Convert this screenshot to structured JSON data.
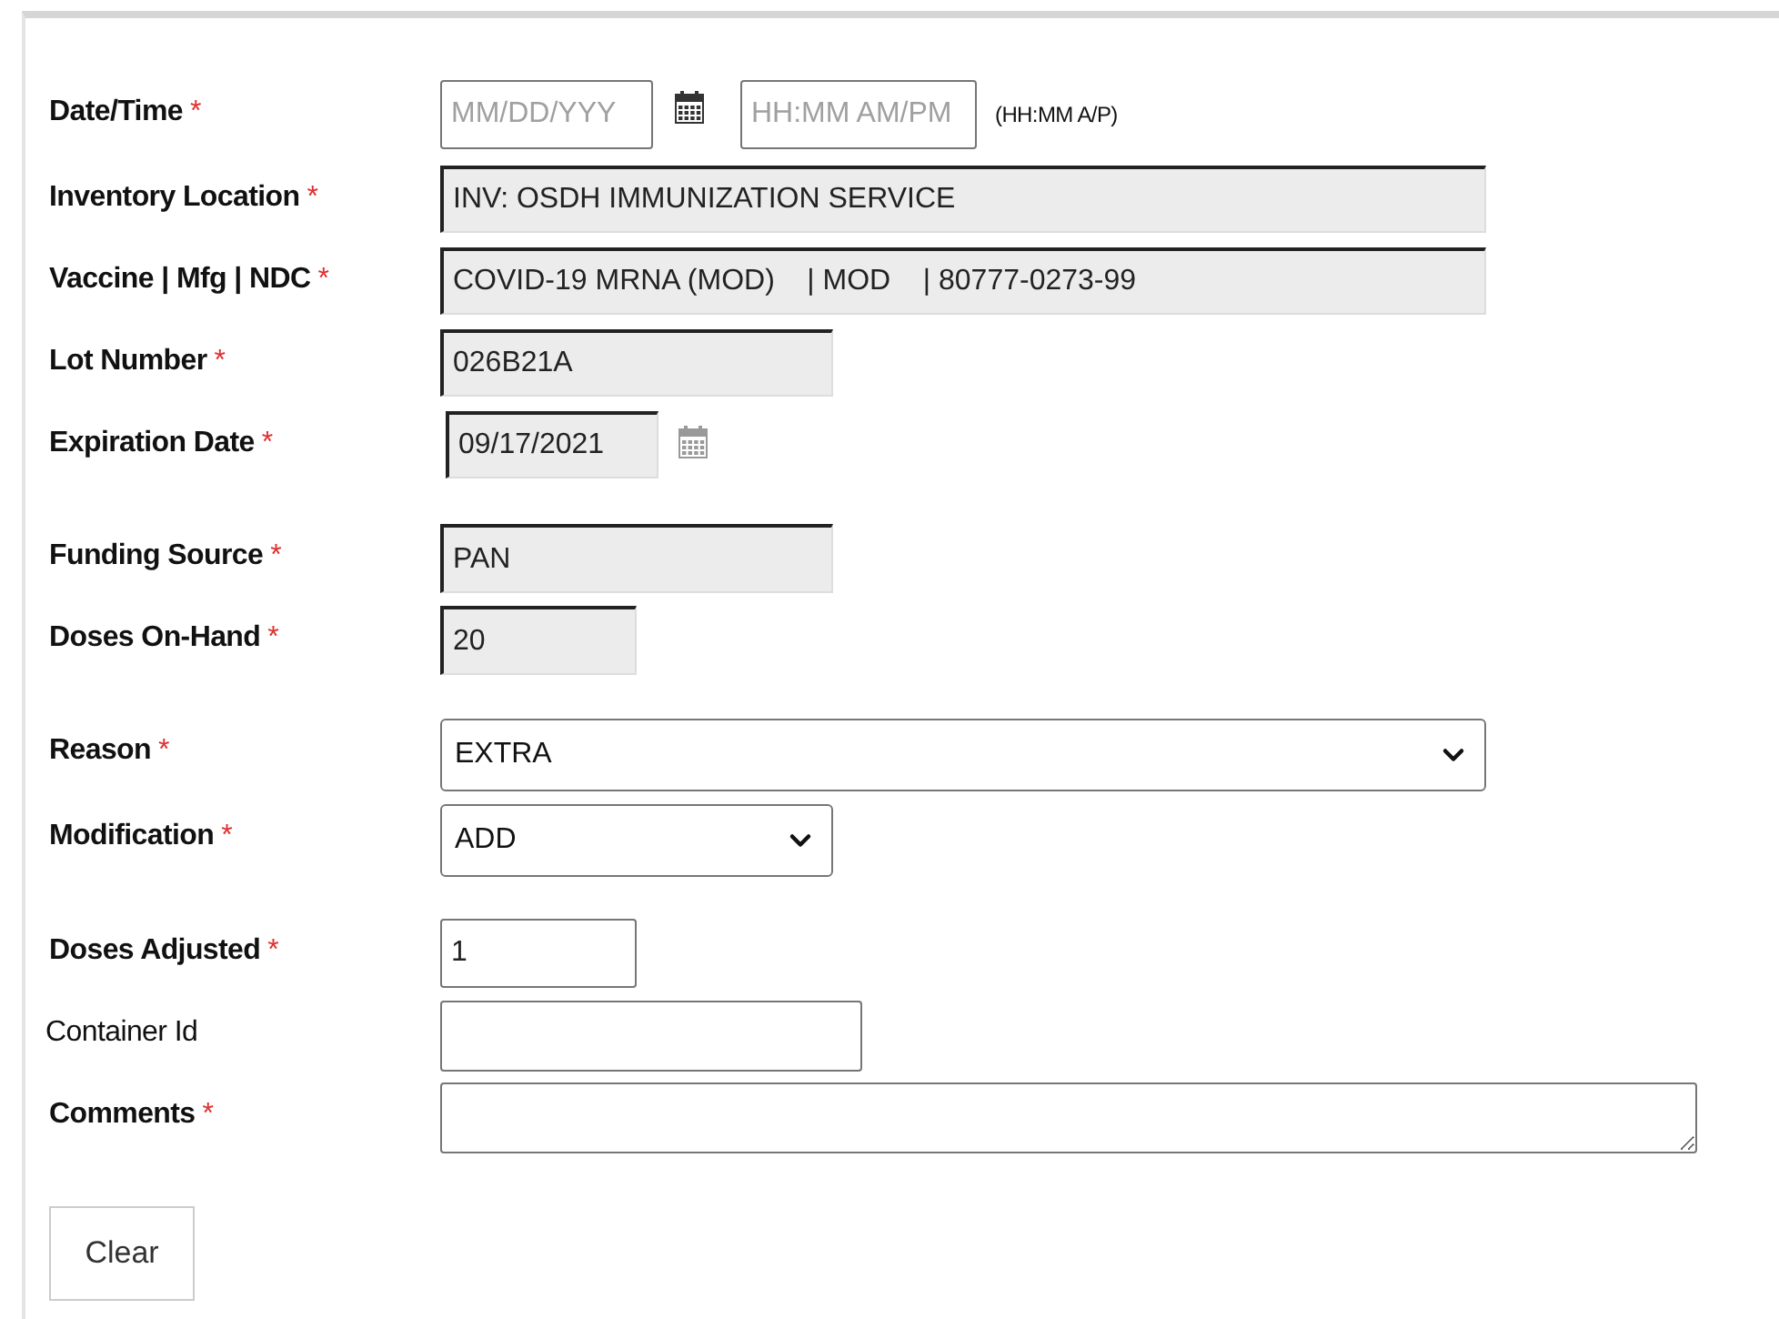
{
  "fields": [
    {
      "label": "Date/Time",
      "asterisk": "*",
      "kind": "datetime",
      "date_placeholder": "MM/DD/YYY",
      "time_placeholder": "HH:MM AM/PM",
      "hint": "(HH:MM A/P)"
    },
    {
      "label": "Inventory Location",
      "asterisk": "*",
      "kind": "readonly",
      "value": "INV: OSDH IMMUNIZATION SERVICE"
    },
    {
      "label": "Vaccine | Mfg | NDC",
      "asterisk": "*",
      "kind": "readonly",
      "value": "COVID-19 MRNA (MOD)    | MOD    | 80777-0273-99"
    },
    {
      "label": "Lot Number",
      "asterisk": "*",
      "kind": "readonly",
      "value": "026B21A"
    },
    {
      "label": "Expiration Date",
      "asterisk": "*",
      "kind": "readonly_date",
      "value": "09/17/2021"
    },
    {
      "label": "Funding Source",
      "asterisk": "*",
      "kind": "readonly",
      "value": "PAN"
    },
    {
      "label": "Doses On-Hand",
      "asterisk": "*",
      "kind": "readonly",
      "value": "20"
    },
    {
      "label": "Reason",
      "asterisk": "*",
      "kind": "select",
      "value": "EXTRA"
    },
    {
      "label": "Modification",
      "asterisk": "*",
      "kind": "select",
      "value": "ADD"
    },
    {
      "label": "Doses Adjusted",
      "asterisk": "*",
      "kind": "input",
      "value": "1"
    },
    {
      "label": "Container Id",
      "kind": "input"
    },
    {
      "label": "Comments",
      "asterisk": "*",
      "kind": "textarea"
    }
  ],
  "buttons": [
    {
      "label": "Clear"
    }
  ]
}
